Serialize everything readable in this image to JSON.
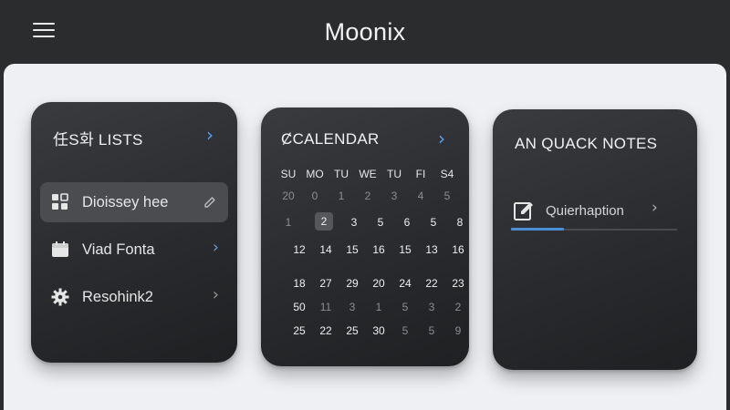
{
  "app": {
    "title": "Moonix"
  },
  "lists": {
    "title": "任S화 LISTS",
    "items": [
      {
        "label": "Dioissey hee",
        "icon": "widgets-icon",
        "trailing": "edit-icon",
        "active": true
      },
      {
        "label": "Viad Fonta",
        "icon": "calendar-icon",
        "trailing": "chevron-right-icon",
        "active": false
      },
      {
        "label": "Resohink2",
        "icon": "gear-icon",
        "trailing": "chevron-right-icon",
        "active": false
      }
    ]
  },
  "calendar": {
    "title": "CALENDAR",
    "title_glyph": "Ȼ",
    "weekdays": [
      "SU",
      "MO",
      "TU",
      "WE",
      "TU",
      "FI",
      "S4"
    ],
    "weeks": [
      [
        "20",
        "0",
        "1",
        "2",
        "3",
        "4",
        "5"
      ],
      [
        "1",
        "2",
        "3",
        "5",
        "6",
        "5",
        "8"
      ],
      [
        "12",
        "14",
        "15",
        "16",
        "15",
        "13",
        "16"
      ],
      [
        "18",
        "27",
        "29",
        "20",
        "24",
        "22",
        "23"
      ],
      [
        "50",
        "11",
        "3",
        "1",
        "5",
        "3",
        "2"
      ],
      [
        "25",
        "22",
        "25",
        "30",
        "5",
        "5",
        "9"
      ]
    ],
    "selected": "2"
  },
  "notes": {
    "title": "AN QUACK NOTES",
    "input_value": "Quierhaption",
    "progress": 0.32
  },
  "colors": {
    "accent": "#5aa0e8",
    "background": "#eef0f3",
    "card": "#2a2b2e",
    "topbar": "#2b2c2e"
  }
}
